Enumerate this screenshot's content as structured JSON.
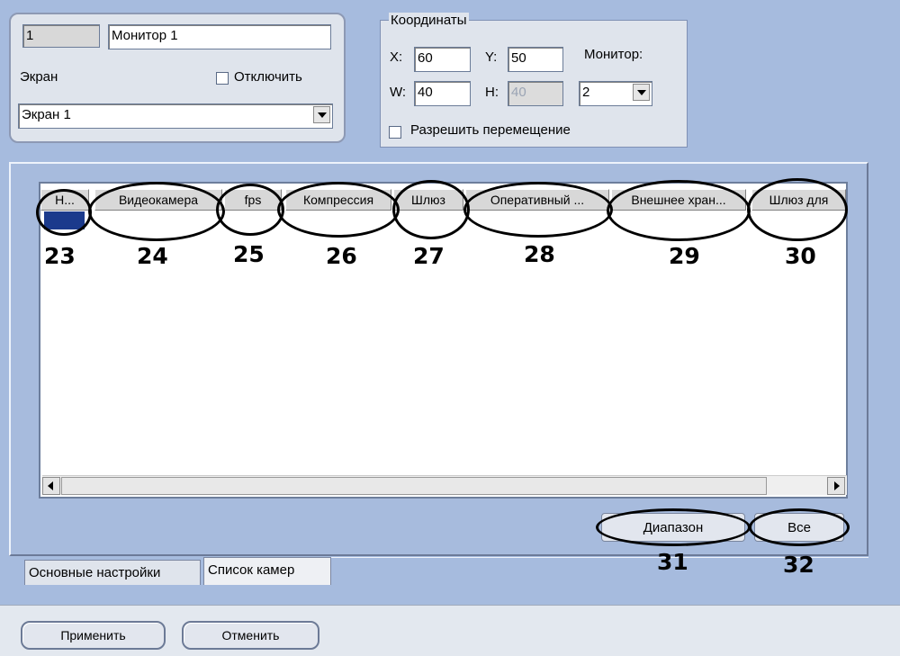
{
  "monitor_panel": {
    "id_value": "1",
    "name_value": "Монитор 1",
    "screen_label": "Экран",
    "disable_label": "Отключить",
    "screen_select_value": "Экран 1"
  },
  "coordinates": {
    "group_label": "Координаты",
    "x_label": "X:",
    "x_value": "60",
    "y_label": "Y:",
    "y_value": "50",
    "w_label": "W:",
    "w_value": "40",
    "h_label": "H:",
    "h_value": "40",
    "monitor_label": "Монитор:",
    "monitor_value": "2",
    "allow_move_label": "Разрешить перемещение"
  },
  "table": {
    "columns": [
      "Н...",
      "Видеокамера",
      "fps",
      "Компрессия",
      "Шлюз",
      "Оперативный ...",
      "Внешнее хран...",
      "Шлюз для"
    ]
  },
  "annotations": {
    "numbers": [
      "23",
      "24",
      "25",
      "26",
      "27",
      "28",
      "29",
      "30",
      "31",
      "32"
    ]
  },
  "buttons": {
    "range": "Диапазон",
    "all": "Все",
    "apply": "Применить",
    "cancel": "Отменить"
  },
  "tabs": [
    "Основные настройки",
    "Список камер"
  ],
  "colors": {
    "panel_blue": "#a6bbde",
    "selection": "#1b3a8c"
  }
}
